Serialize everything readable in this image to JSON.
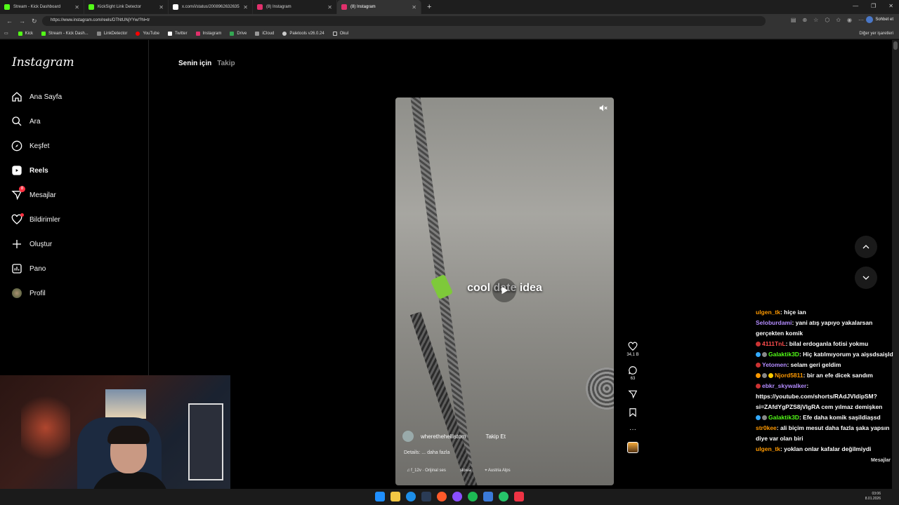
{
  "browser": {
    "tabs": [
      {
        "title": "Stream - Kick Dashboard",
        "color": "#53fc18"
      },
      {
        "title": "KickSight Link Detector",
        "color": "#53fc18"
      },
      {
        "title": "x.com/i/status/2008962632635",
        "color": "#ffffff"
      },
      {
        "title": "(8) Instagram",
        "color": "#e1306c"
      },
      {
        "title": "(8) Instagram",
        "color": "#e1306c"
      }
    ],
    "url": "https://www.instagram.com/reels/DTNtUNjYYw/?hl=tr",
    "chat_button": "Sohbet et",
    "bookmarks": [
      {
        "label": "Kick",
        "color": "#53fc18"
      },
      {
        "label": "Stream - Kick Dash...",
        "color": "#53fc18"
      },
      {
        "label": "LinkDetector",
        "color": "#888888"
      },
      {
        "label": "YouTube",
        "color": "#ff0000"
      },
      {
        "label": "Twitter",
        "color": "#ffffff"
      },
      {
        "label": "Instagram",
        "color": "#e1306c"
      },
      {
        "label": "Drive",
        "color": "#34a853"
      },
      {
        "label": "iCloud",
        "color": "#999999"
      },
      {
        "label": "Paletools v26.0.24",
        "color": "#cccccc"
      },
      {
        "label": "Okul",
        "color": "#cccccc"
      }
    ],
    "bookmarks_other": "Diğer yer işaretleri"
  },
  "instagram": {
    "logo": "Instagram",
    "nav": [
      {
        "label": "Ana Sayfa",
        "icon": "home-icon"
      },
      {
        "label": "Ara",
        "icon": "search-icon"
      },
      {
        "label": "Keşfet",
        "icon": "compass-icon"
      },
      {
        "label": "Reels",
        "icon": "reels-icon"
      },
      {
        "label": "Mesajlar",
        "icon": "messenger-icon",
        "badge": "8"
      },
      {
        "label": "Bildirimler",
        "icon": "heart-icon"
      },
      {
        "label": "Oluştur",
        "icon": "plus-icon"
      },
      {
        "label": "Pano",
        "icon": "dashboard-icon"
      },
      {
        "label": "Profil",
        "icon": "profile-avatar"
      }
    ],
    "feed_tabs": {
      "for_you": "Senin için",
      "following": "Takip"
    },
    "reel": {
      "overlay_text": "cool date idea",
      "author": "wherethehellistom",
      "follow": "Takip Et",
      "details": "Details: ... daha fazla",
      "audio": "f_12v · Orijinal ses",
      "audio2": "slowa",
      "location": "Austria Alps",
      "likes": "34,1 B",
      "comments": "63"
    }
  },
  "chat": {
    "messages": [
      {
        "user": "ulgen_tk",
        "text": ": hiçe ian",
        "color": "#ff9900"
      },
      {
        "user": "Seloburdami",
        "text": ": yani atış yapıyo yakalarsan gerçekten komik",
        "color": "#b48cff"
      },
      {
        "user": "4111TnL",
        "text": ": bilal erdoganla fotisi yokmu",
        "color": "#ff4d4d"
      },
      {
        "user": "Galaktik3D",
        "text": ": Hiç katılmıyorum ya aişsdsaişld",
        "color": "#53fc18"
      },
      {
        "user": "Yetomen",
        "text": ": selam geri geldim",
        "color": "#b48cff"
      },
      {
        "user": "Njord5811",
        "text": ": bir an efe dicek sandım",
        "color": "#ff9900"
      },
      {
        "user": "ebkr_skywalker",
        "text": ": https://youtube.com/shorts/RAdJVIdipSM?si=ZAfdYgPZS8jVlgRA cem yılmaz demişken",
        "color": "#b48cff"
      },
      {
        "user": "Galaktik3D",
        "text": ": Efe daha komik saşildiaşsd",
        "color": "#53fc18"
      },
      {
        "user": "str0kee",
        "text": ": ali biçim mesut daha fazla şaka yapsın diye var olan biri",
        "color": "#ff9900"
      },
      {
        "user": "ulgen_tk",
        "text": ": yoklan onlar kafalar değilmiydi",
        "color": "#ff9900"
      }
    ],
    "input_hint": "Mesajlar"
  },
  "system": {
    "time": "03:06",
    "date": "8.01.2026"
  }
}
